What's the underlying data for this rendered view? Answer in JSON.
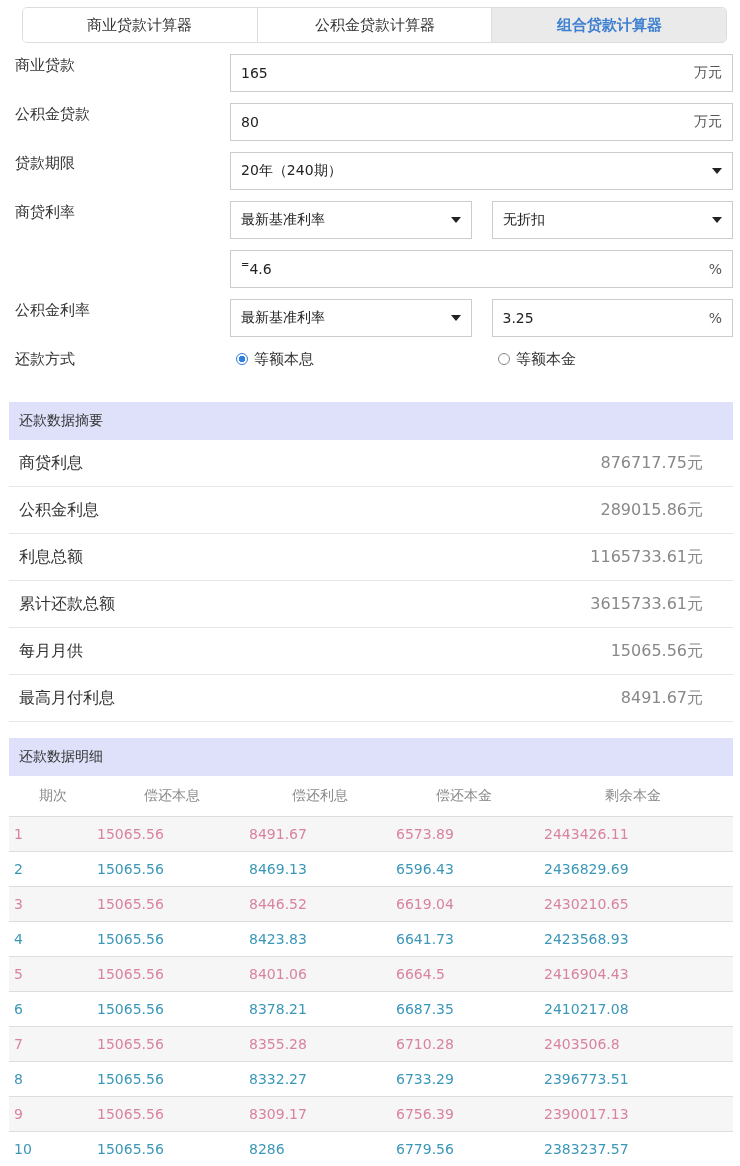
{
  "tabs": [
    {
      "label": "商业贷款计算器",
      "selected": false
    },
    {
      "label": "公积金贷款计算器",
      "selected": false
    },
    {
      "label": "组合贷款计算器",
      "selected": true
    }
  ],
  "form": [
    {
      "label": "商业贷款",
      "controls": [
        {
          "kind": "input",
          "value": "165",
          "unit": "万元"
        }
      ]
    },
    {
      "label": "公积金贷款",
      "controls": [
        {
          "kind": "input",
          "value": "80",
          "unit": "万元"
        }
      ]
    },
    {
      "label": "贷款期限",
      "controls": [
        {
          "kind": "select",
          "value": "20年（240期）"
        }
      ]
    },
    {
      "label": "商贷利率",
      "controls": [
        {
          "kind": "select",
          "value": "最新基准利率"
        },
        {
          "kind": "select",
          "value": "无折扣"
        }
      ]
    },
    {
      "controls": [
        {
          "kind": "input",
          "prefix": "=",
          "value": "4.6",
          "unit": "%"
        }
      ]
    },
    {
      "label": "公积金利率",
      "controls": [
        {
          "kind": "select",
          "value": "最新基准利率"
        },
        {
          "kind": "input",
          "value": "3.25",
          "unit": "%"
        }
      ]
    },
    {
      "label": "还款方式",
      "controls": [
        {
          "kind": "radio",
          "label": "等额本息",
          "selected": true
        },
        {
          "kind": "radio",
          "label": "等额本金",
          "selected": false
        }
      ]
    }
  ],
  "summary": {
    "title": "还款数据摘要",
    "rows": [
      {
        "label": "商贷利息",
        "value": "876717.75元"
      },
      {
        "label": "公积金利息",
        "value": "289015.86元"
      },
      {
        "label": "利息总额",
        "value": "1165733.61元"
      },
      {
        "label": "累计还款总额",
        "value": "3615733.61元"
      },
      {
        "label": "每月月供",
        "value": "15065.56元"
      },
      {
        "label": "最高月付利息",
        "value": "8491.67元"
      }
    ]
  },
  "detail": {
    "title": "还款数据明细",
    "columns": [
      "期次",
      "偿还本息",
      "偿还利息",
      "偿还本金",
      "剩余本金"
    ],
    "rows": [
      {
        "cells": [
          "1",
          "15065.56",
          "8491.67",
          "6573.89",
          "2443426.11"
        ],
        "color": "#d9839e"
      },
      {
        "cells": [
          "2",
          "15065.56",
          "8469.13",
          "6596.43",
          "2436829.69"
        ],
        "color": "#3a97b8"
      },
      {
        "cells": [
          "3",
          "15065.56",
          "8446.52",
          "6619.04",
          "2430210.65"
        ],
        "color": "#d9839e"
      },
      {
        "cells": [
          "4",
          "15065.56",
          "8423.83",
          "6641.73",
          "2423568.93"
        ],
        "color": "#3a97b8"
      },
      {
        "cells": [
          "5",
          "15065.56",
          "8401.06",
          "6664.5",
          "2416904.43"
        ],
        "color": "#d9839e"
      },
      {
        "cells": [
          "6",
          "15065.56",
          "8378.21",
          "6687.35",
          "2410217.08"
        ],
        "color": "#3a97b8"
      },
      {
        "cells": [
          "7",
          "15065.56",
          "8355.28",
          "6710.28",
          "2403506.8"
        ],
        "color": "#d9839e"
      },
      {
        "cells": [
          "8",
          "15065.56",
          "8332.27",
          "6733.29",
          "2396773.51"
        ],
        "color": "#3a97b8"
      },
      {
        "cells": [
          "9",
          "15065.56",
          "8309.17",
          "6756.39",
          "2390017.13"
        ],
        "color": "#d9839e"
      },
      {
        "cells": [
          "10",
          "15065.56",
          "8286",
          "6779.56",
          "2383237.57"
        ],
        "color": "#3a97b8"
      }
    ]
  }
}
